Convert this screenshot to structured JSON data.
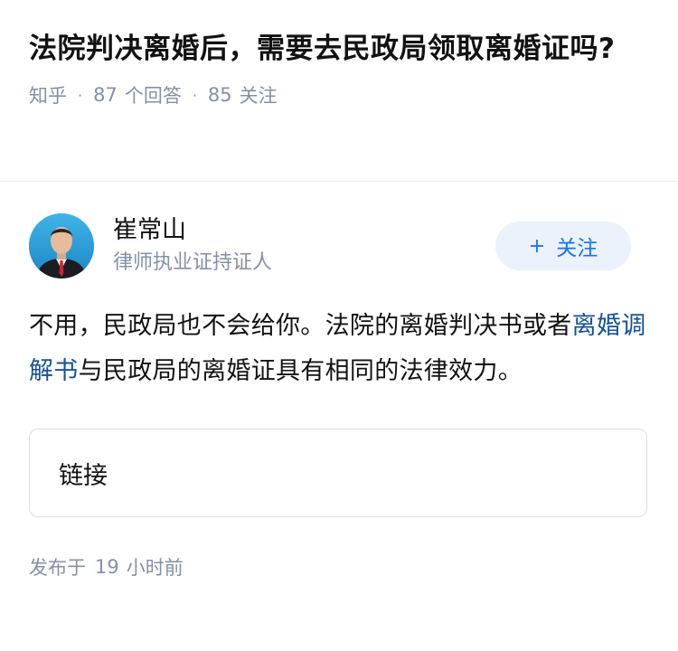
{
  "question": {
    "title": "法院判决离婚后，需要去民政局领取离婚证吗?",
    "source": "知乎",
    "answer_count": "87",
    "answer_label": "个回答",
    "follower_count": "85",
    "follower_label": "关注"
  },
  "author": {
    "name": "崔常山",
    "badge": "律师执业证持证人",
    "avatar_icon": "person-avatar-icon",
    "follow_icon": "plus-icon",
    "follow_label": "关注"
  },
  "answer": {
    "text_before": "不用，民政局也不会给你。法院的离婚判决书或者",
    "link_text": "离婚调解书",
    "text_after": "与民政局的离婚证具有相同的法律效力。",
    "link_card_label": "链接",
    "published_prefix": "发布于",
    "published_num": "19",
    "published_suffix": "小时前"
  },
  "colors": {
    "link": "#175199",
    "accent": "#1772f6",
    "muted": "#8590a6",
    "follow_bg": "#ebf2fb"
  }
}
